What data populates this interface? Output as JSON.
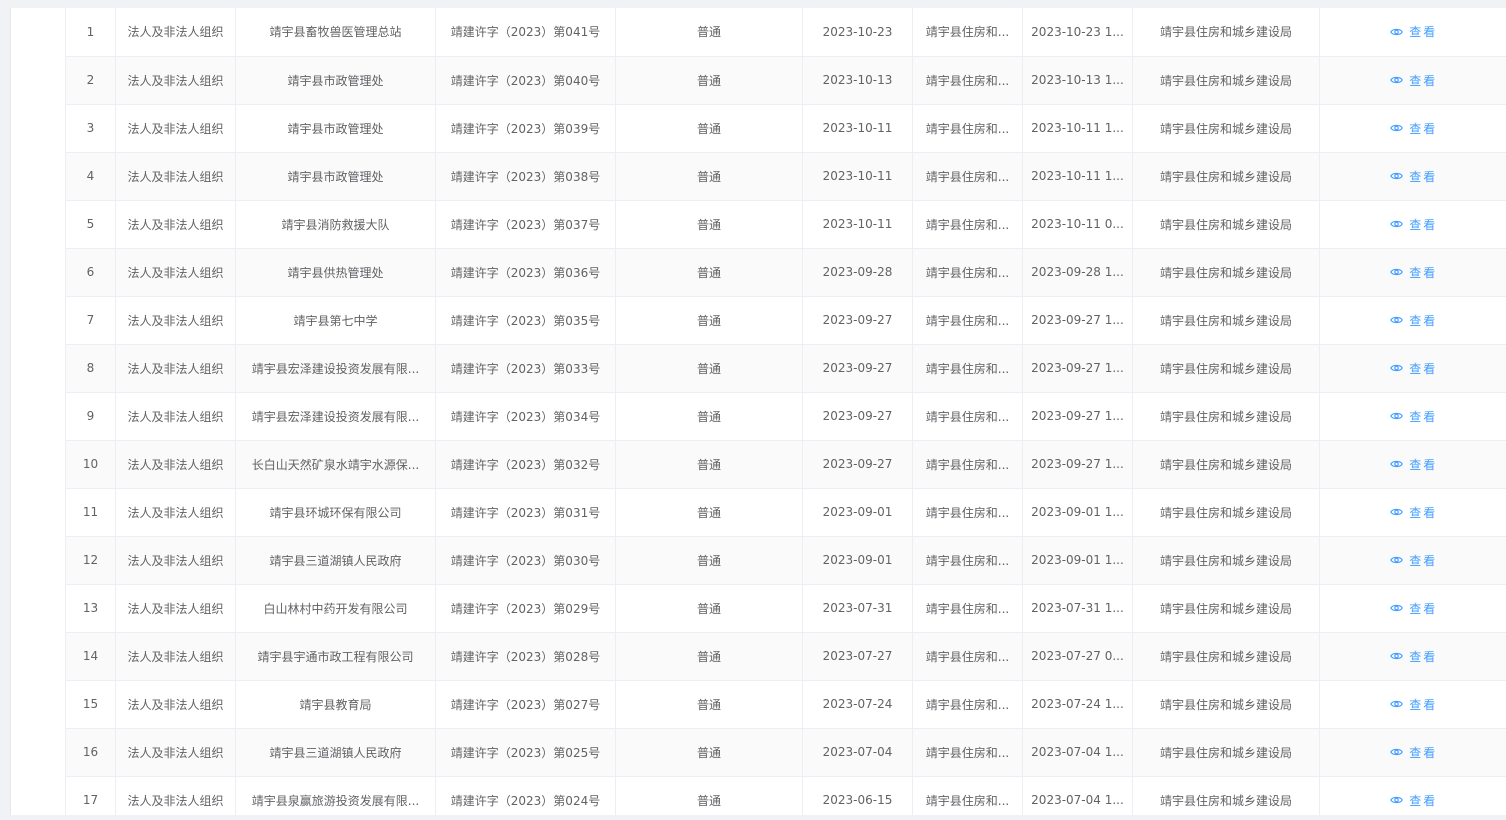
{
  "table": {
    "view_label": "查看",
    "rows": [
      {
        "no": "1",
        "type": "法人及非法人组织",
        "name": "靖宇县畜牧兽医管理总站",
        "permit": "靖建许字（2023）第041号",
        "category": "普通",
        "date": "2023-10-23",
        "org": "靖宇县住房和...",
        "time": "2023-10-23 1...",
        "dept": "靖宇县住房和城乡建设局"
      },
      {
        "no": "2",
        "type": "法人及非法人组织",
        "name": "靖宇县市政管理处",
        "permit": "靖建许字（2023）第040号",
        "category": "普通",
        "date": "2023-10-13",
        "org": "靖宇县住房和...",
        "time": "2023-10-13 1...",
        "dept": "靖宇县住房和城乡建设局"
      },
      {
        "no": "3",
        "type": "法人及非法人组织",
        "name": "靖宇县市政管理处",
        "permit": "靖建许字（2023）第039号",
        "category": "普通",
        "date": "2023-10-11",
        "org": "靖宇县住房和...",
        "time": "2023-10-11 1...",
        "dept": "靖宇县住房和城乡建设局"
      },
      {
        "no": "4",
        "type": "法人及非法人组织",
        "name": "靖宇县市政管理处",
        "permit": "靖建许字（2023）第038号",
        "category": "普通",
        "date": "2023-10-11",
        "org": "靖宇县住房和...",
        "time": "2023-10-11 1...",
        "dept": "靖宇县住房和城乡建设局"
      },
      {
        "no": "5",
        "type": "法人及非法人组织",
        "name": "靖宇县消防救援大队",
        "permit": "靖建许字（2023）第037号",
        "category": "普通",
        "date": "2023-10-11",
        "org": "靖宇县住房和...",
        "time": "2023-10-11 0...",
        "dept": "靖宇县住房和城乡建设局"
      },
      {
        "no": "6",
        "type": "法人及非法人组织",
        "name": "靖宇县供热管理处",
        "permit": "靖建许字（2023）第036号",
        "category": "普通",
        "date": "2023-09-28",
        "org": "靖宇县住房和...",
        "time": "2023-09-28 1...",
        "dept": "靖宇县住房和城乡建设局"
      },
      {
        "no": "7",
        "type": "法人及非法人组织",
        "name": "靖宇县第七中学",
        "permit": "靖建许字（2023）第035号",
        "category": "普通",
        "date": "2023-09-27",
        "org": "靖宇县住房和...",
        "time": "2023-09-27 1...",
        "dept": "靖宇县住房和城乡建设局"
      },
      {
        "no": "8",
        "type": "法人及非法人组织",
        "name": "靖宇县宏泽建设投资发展有限...",
        "permit": "靖建许字（2023）第033号",
        "category": "普通",
        "date": "2023-09-27",
        "org": "靖宇县住房和...",
        "time": "2023-09-27 1...",
        "dept": "靖宇县住房和城乡建设局"
      },
      {
        "no": "9",
        "type": "法人及非法人组织",
        "name": "靖宇县宏泽建设投资发展有限...",
        "permit": "靖建许字（2023）第034号",
        "category": "普通",
        "date": "2023-09-27",
        "org": "靖宇县住房和...",
        "time": "2023-09-27 1...",
        "dept": "靖宇县住房和城乡建设局"
      },
      {
        "no": "10",
        "type": "法人及非法人组织",
        "name": "长白山天然矿泉水靖宇水源保...",
        "permit": "靖建许字（2023）第032号",
        "category": "普通",
        "date": "2023-09-27",
        "org": "靖宇县住房和...",
        "time": "2023-09-27 1...",
        "dept": "靖宇县住房和城乡建设局"
      },
      {
        "no": "11",
        "type": "法人及非法人组织",
        "name": "靖宇县环城环保有限公司",
        "permit": "靖建许字（2023）第031号",
        "category": "普通",
        "date": "2023-09-01",
        "org": "靖宇县住房和...",
        "time": "2023-09-01 1...",
        "dept": "靖宇县住房和城乡建设局"
      },
      {
        "no": "12",
        "type": "法人及非法人组织",
        "name": "靖宇县三道湖镇人民政府",
        "permit": "靖建许字（2023）第030号",
        "category": "普通",
        "date": "2023-09-01",
        "org": "靖宇县住房和...",
        "time": "2023-09-01 1...",
        "dept": "靖宇县住房和城乡建设局"
      },
      {
        "no": "13",
        "type": "法人及非法人组织",
        "name": "白山林村中药开发有限公司",
        "permit": "靖建许字（2023）第029号",
        "category": "普通",
        "date": "2023-07-31",
        "org": "靖宇县住房和...",
        "time": "2023-07-31 1...",
        "dept": "靖宇县住房和城乡建设局"
      },
      {
        "no": "14",
        "type": "法人及非法人组织",
        "name": "靖宇县宇通市政工程有限公司",
        "permit": "靖建许字（2023）第028号",
        "category": "普通",
        "date": "2023-07-27",
        "org": "靖宇县住房和...",
        "time": "2023-07-27 0...",
        "dept": "靖宇县住房和城乡建设局"
      },
      {
        "no": "15",
        "type": "法人及非法人组织",
        "name": "靖宇县教育局",
        "permit": "靖建许字（2023）第027号",
        "category": "普通",
        "date": "2023-07-24",
        "org": "靖宇县住房和...",
        "time": "2023-07-24 1...",
        "dept": "靖宇县住房和城乡建设局"
      },
      {
        "no": "16",
        "type": "法人及非法人组织",
        "name": "靖宇县三道湖镇人民政府",
        "permit": "靖建许字（2023）第025号",
        "category": "普通",
        "date": "2023-07-04",
        "org": "靖宇县住房和...",
        "time": "2023-07-04 1...",
        "dept": "靖宇县住房和城乡建设局"
      },
      {
        "no": "17",
        "type": "法人及非法人组织",
        "name": "靖宇县泉赢旅游投资发展有限...",
        "permit": "靖建许字（2023）第024号",
        "category": "普通",
        "date": "2023-06-15",
        "org": "靖宇县住房和...",
        "time": "2023-07-04 1...",
        "dept": "靖宇县住房和城乡建设局"
      }
    ]
  }
}
